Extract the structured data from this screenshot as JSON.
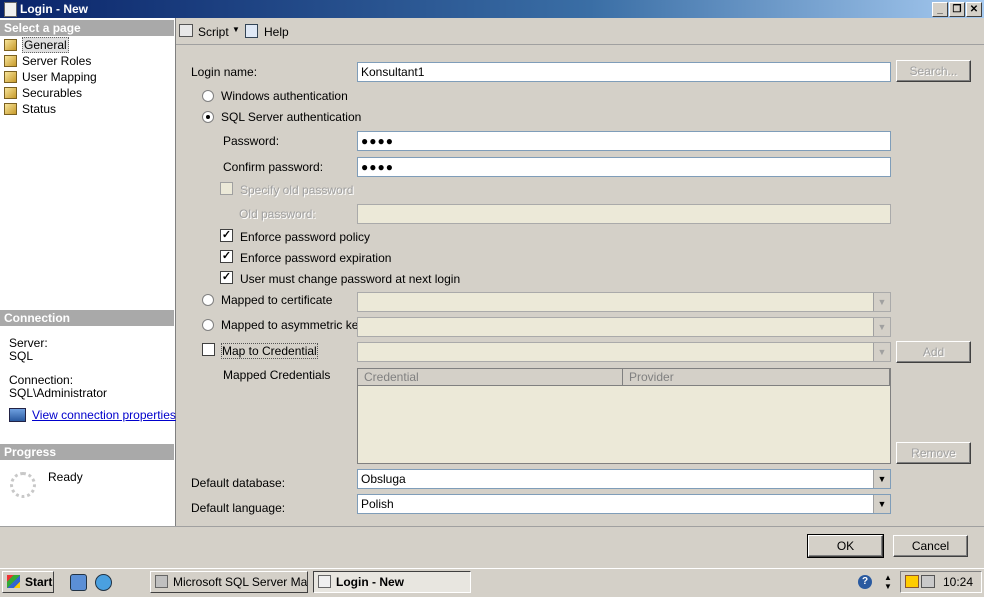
{
  "window": {
    "title": "Login - New"
  },
  "left": {
    "select_header": "Select a page",
    "pages": [
      "General",
      "Server Roles",
      "User Mapping",
      "Securables",
      "Status"
    ],
    "connection_header": "Connection",
    "server_label": "Server:",
    "server_value": "SQL",
    "connection_label": "Connection:",
    "connection_value": "SQL\\Administrator",
    "view_props": "View connection properties",
    "progress_header": "Progress",
    "progress_status": "Ready"
  },
  "toolbar": {
    "script": "Script",
    "help": "Help"
  },
  "form": {
    "login_name_label": "Login name:",
    "login_name_value": "Konsultant1",
    "search_btn": "Search...",
    "windows_auth": "Windows authentication",
    "sql_auth": "SQL Server authentication",
    "password_label": "Password:",
    "password_value": "●●●●",
    "confirm_label": "Confirm password:",
    "confirm_value": "●●●●",
    "specify_old": "Specify old password",
    "old_password_label": "Old password:",
    "enforce_policy": "Enforce password policy",
    "enforce_expiration": "Enforce password expiration",
    "must_change": "User must change password at next login",
    "mapped_cert": "Mapped to certificate",
    "mapped_asym": "Mapped to asymmetric key",
    "map_credential": "Map to Credential",
    "add_btn": "Add",
    "mapped_credentials": "Mapped Credentials",
    "col_credential": "Credential",
    "col_provider": "Provider",
    "remove_btn": "Remove",
    "default_db_label": "Default database:",
    "default_db_value": "Obsluga",
    "default_lang_label": "Default language:",
    "default_lang_value": "Polish"
  },
  "footer": {
    "ok": "OK",
    "cancel": "Cancel"
  },
  "taskbar": {
    "start": "Start",
    "task1": "Microsoft SQL Server Ma...",
    "task2": "Login - New",
    "clock": "10:24"
  }
}
